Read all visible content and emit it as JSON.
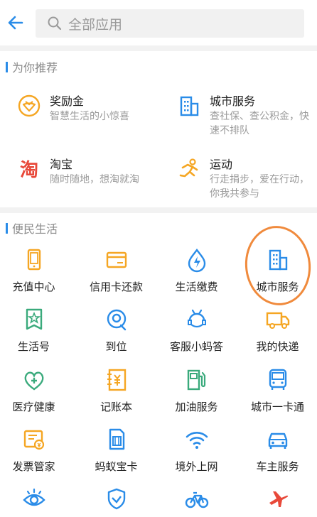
{
  "header": {
    "search_placeholder": "全部应用"
  },
  "recommend": {
    "title": "为你推荐",
    "items": [
      {
        "title": "奖励金",
        "desc": "智慧生活的小惊喜"
      },
      {
        "title": "城市服务",
        "desc": "查社保、查公积金，快速不排队"
      },
      {
        "title": "淘宝",
        "desc": "随时随地，想淘就淘"
      },
      {
        "title": "运动",
        "desc": "行走捐步，爱在行动，你我共参与"
      }
    ]
  },
  "life": {
    "title": "便民生活",
    "items": [
      {
        "label": "充值中心"
      },
      {
        "label": "信用卡还款"
      },
      {
        "label": "生活缴费"
      },
      {
        "label": "城市服务"
      },
      {
        "label": "生活号"
      },
      {
        "label": "到位"
      },
      {
        "label": "客服小蚂答"
      },
      {
        "label": "我的快递"
      },
      {
        "label": "医疗健康"
      },
      {
        "label": "记账本"
      },
      {
        "label": "加油服务"
      },
      {
        "label": "城市一卡通"
      },
      {
        "label": "发票管家"
      },
      {
        "label": "蚂蚁宝卡"
      },
      {
        "label": "境外上网"
      },
      {
        "label": "车主服务"
      }
    ]
  },
  "colors": {
    "accent": "#2a8ce8",
    "orange": "#f5a623",
    "annotation": "#f08a3c"
  }
}
